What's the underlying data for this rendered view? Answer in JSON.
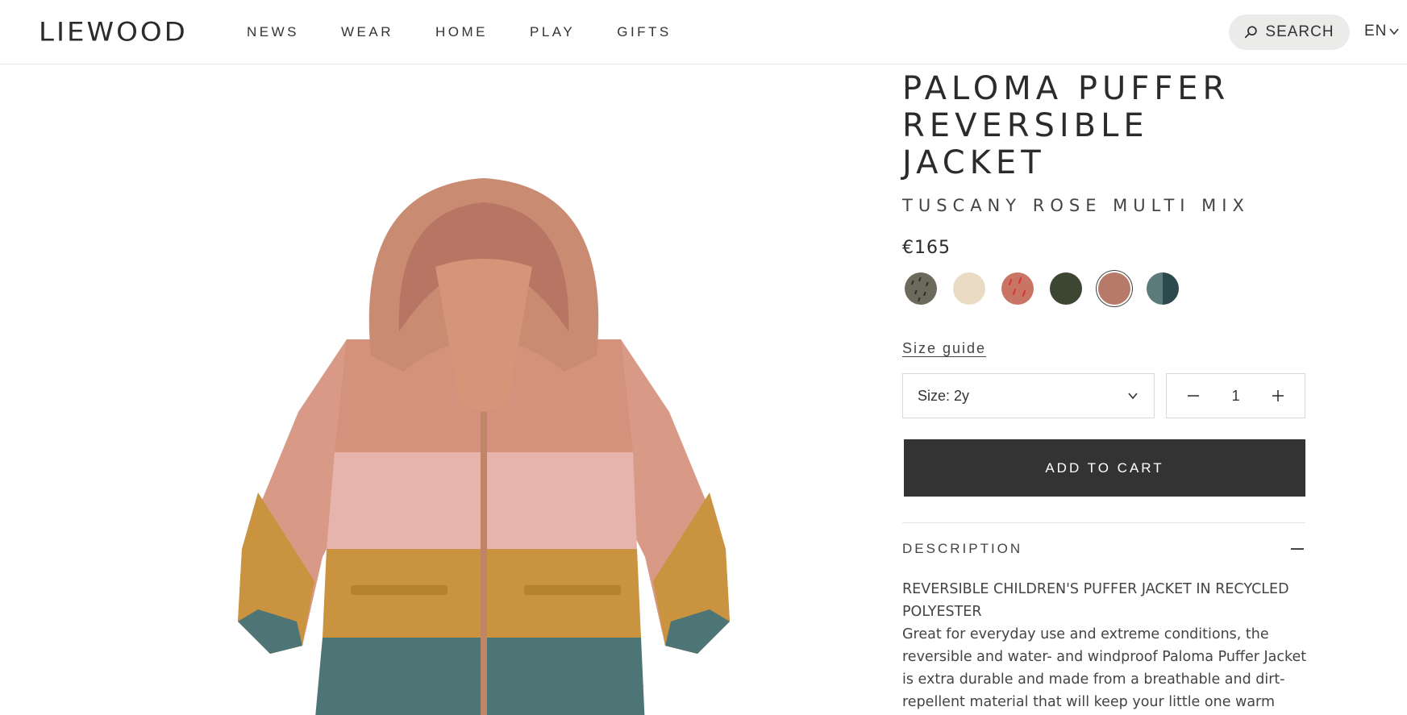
{
  "header": {
    "logo": "LIEWOOD",
    "nav": [
      "NEWS",
      "WEAR",
      "HOME",
      "PLAY",
      "GIFTS"
    ],
    "search_label": "SEARCH",
    "language": "EN"
  },
  "product": {
    "title_line1": "PALOMA PUFFER",
    "title_line2": "REVERSIBLE JACKET",
    "color_name": "TUSCANY ROSE MULTI MIX",
    "price": "€165",
    "swatches": [
      {
        "name": "dark-dotted",
        "color": "#6b6a5c"
      },
      {
        "name": "sandy",
        "color": "#eadbc4"
      },
      {
        "name": "red-pattern",
        "color": "#c97566"
      },
      {
        "name": "army-green",
        "color": "#3d4632"
      },
      {
        "name": "tuscany-rose",
        "color": "#b87a68",
        "selected": true
      },
      {
        "name": "whale-blue",
        "color": "#3c5a5c"
      }
    ],
    "size_guide_label": "Size guide",
    "size_label": "Size: 2y",
    "quantity": "1",
    "add_to_cart_label": "ADD TO CART"
  },
  "description": {
    "header": "DESCRIPTION",
    "headline": "REVERSIBLE CHILDREN'S PUFFER JACKET IN RECYCLED POLYESTER",
    "body": "Great for everyday use and extreme conditions, the reversible and water- and windproof Paloma Puffer Jacket is extra durable and made from a breathable and dirt-repellent material that will keep your little one warm without working up a sweat."
  },
  "colors": {
    "button_bg": "#333333",
    "search_bg": "#ebebea",
    "jacket_top": "#c98b72",
    "jacket_pink": "#e6b4ad",
    "jacket_mustard": "#c9933f",
    "jacket_teal": "#4e7576"
  }
}
